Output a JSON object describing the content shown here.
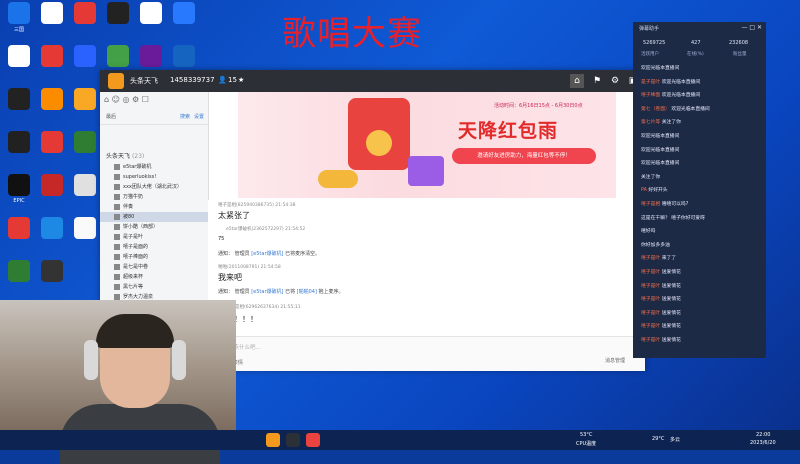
{
  "desktop": {
    "title": "歌唱大赛",
    "icons": [
      {
        "label": "三国",
        "color": "#1a73e8"
      },
      {
        "label": "",
        "color": "#ffffff"
      },
      {
        "label": "",
        "color": "#e53935"
      },
      {
        "label": "",
        "color": "#222"
      },
      {
        "label": "",
        "color": "#fff"
      },
      {
        "label": "",
        "color": "#2979ff"
      },
      {
        "label": "",
        "color": "#fff"
      },
      {
        "label": "",
        "color": "#e53935"
      },
      {
        "label": "",
        "color": "#2962ff"
      },
      {
        "label": "",
        "color": "#43a047"
      },
      {
        "label": "",
        "color": "#6a1b9a"
      },
      {
        "label": "",
        "color": "#1565c0"
      },
      {
        "label": "",
        "color": "#222"
      },
      {
        "label": "",
        "color": "#fb8c00"
      },
      {
        "label": "",
        "color": "#f9a825"
      },
      {
        "label": "",
        "color": "#212121"
      },
      {
        "label": "",
        "color": "#212121"
      },
      {
        "label": "",
        "color": "#e53935"
      },
      {
        "label": "",
        "color": "#2e7d32"
      },
      {
        "label": "",
        "color": "#1976d2"
      },
      {
        "label": "EPIC",
        "color": "#111"
      },
      {
        "label": "",
        "color": "#c62828"
      },
      {
        "label": "",
        "color": "#e0e0e0"
      },
      {
        "label": "",
        "color": "#f9a825"
      },
      {
        "label": "",
        "color": "#e53935"
      },
      {
        "label": "",
        "color": "#1e88e5"
      },
      {
        "label": "",
        "color": "#fafafa"
      },
      {
        "label": "",
        "color": "#222"
      },
      {
        "label": "",
        "color": "#2e7d32"
      },
      {
        "label": "",
        "color": "#333"
      }
    ]
  },
  "app": {
    "window_title": "头条天飞",
    "room_id": "1458339737",
    "fans": "15",
    "sidebar": {
      "sub_label": "最后",
      "links": [
        "搜索",
        "设置"
      ],
      "tree_head": "头条天飞",
      "tree_head_count": "(23)",
      "items": [
        "e5tar爆破机",
        "superluokiss!",
        "xxx团队大佬（湖北武汉）",
        "万猫牛奶",
        "伴奏",
        "被80",
        "饼小酷（西部）",
        "是子是叶",
        "嘻子是面的",
        "嘻子棒面的",
        "是七是中卷",
        "超级来杯",
        "黑七片等",
        "罗杰大力温泉",
        "青豆阿飒鱼"
      ]
    },
    "banner": {
      "time": "活动时间：6月16日15点 - 6月30日0点",
      "headline": "天降红包雨",
      "pill": "邀请好友进房助力，海量红包等不停！"
    },
    "chat": {
      "m1_meta": "嘻子是相(825940386735) 21:54:38",
      "m1_body": "太紧张了",
      "m2_meta": "e5tar爆破机(2362572297) 21:54:52",
      "m2_body": "75",
      "m3_sys_a": "通知：",
      "m3_sys_b": "管理员",
      "m3_sys_c": "[e5tar爆破机]",
      "m3_sys_d": "已将麦序清空。",
      "m4_meta": "啪啪(2011008791) 21:54:58",
      "m4_body": "我来吧",
      "m5_sys_a": "通知：",
      "m5_sys_b": "管理员",
      "m5_sys_c": "[e5tar爆破机]",
      "m5_sys_d": "已将",
      "m5_sys_e": "[啪啪04]",
      "m5_sys_f": "抱上麦序。",
      "m6_meta": "嘻子是相(62962637634) 21:55:11",
      "m6_body": "加油！！！"
    },
    "input": {
      "placeholder": "说点什么吧...",
      "tools": "表情",
      "send": "消息管理"
    }
  },
  "right_panel": {
    "title": "弹幕助手",
    "stats": [
      {
        "value": "5269725",
        "label": "活跃用户"
      },
      {
        "value": "427",
        "label": "在线(%)"
      },
      {
        "value": "232608",
        "label": "粉丝量"
      }
    ],
    "lines": [
      {
        "name": "",
        "text": "欢迎光临本直播间"
      },
      {
        "name": "是子是叶",
        "text": "欢迎光临本直播间"
      },
      {
        "name": "嘻子棒面",
        "text": "欢迎光临本直播间"
      },
      {
        "name": "第七（卷面）",
        "text": "欢迎光临本直播间"
      },
      {
        "name": "第七片等",
        "text": "关注了你"
      },
      {
        "name": "",
        "text": "欢迎光临本直播间"
      },
      {
        "name": "",
        "text": "欢迎光临本直播间"
      },
      {
        "name": "",
        "text": "欢迎光临本直播间"
      },
      {
        "name": "",
        "text": "关注了你"
      },
      {
        "name": "PA",
        "text": "好好开头"
      },
      {
        "name": "嘻子是相",
        "text": "嘻嘻可以吗?"
      },
      {
        "name": "",
        "text": "这是在干嘛？ 嘻子你好可爱呀"
      },
      {
        "name": "",
        "text": "嘻好吗"
      },
      {
        "name": "",
        "text": "你好加多多油"
      },
      {
        "name": "嘻子是叶",
        "text": "来了了"
      },
      {
        "name": "嘻子是叶",
        "text": "送爱情花"
      },
      {
        "name": "嘻子是叶",
        "text": "送爱情花"
      },
      {
        "name": "嘻子是叶",
        "text": "送爱情花"
      },
      {
        "name": "嘻子是叶",
        "text": "送爱情花"
      },
      {
        "name": "嘻子是叶",
        "text": "送爱情花"
      },
      {
        "name": "嘻子是叶",
        "text": "送爱情花"
      }
    ]
  },
  "taskbar": {
    "cpu_temp": "53°C",
    "cpu_label": "CPU温度",
    "weather_temp": "29°C",
    "weather_desc": "多云",
    "time": "22:00",
    "date": "2023/6/20"
  }
}
